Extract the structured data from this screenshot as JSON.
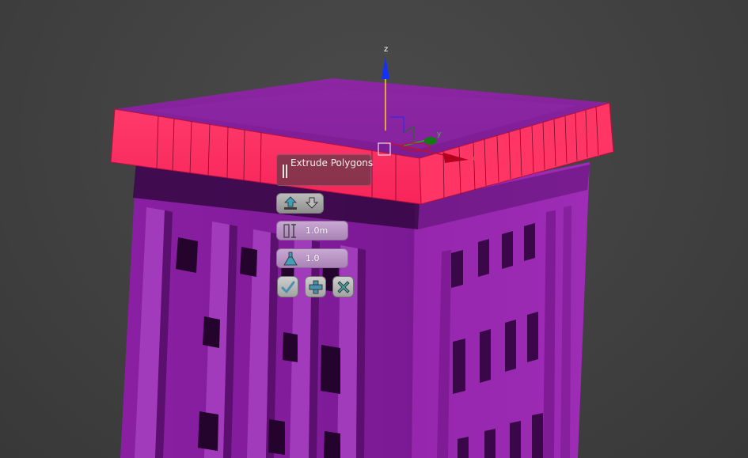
{
  "viewport": {
    "background": "#434343",
    "building_color": "#9b2bb3",
    "selected_face_color": "#ff2f63",
    "roof_color": "#8b249f"
  },
  "gizmo": {
    "z_label": "z",
    "x_label": "x",
    "y_label": "y"
  },
  "caddy": {
    "title": "Extrude Polygons",
    "group_mode_icon": "extrude-group-icon",
    "height_value": "1.0m",
    "height_icon": "height-icon",
    "bias_value": "1.0",
    "bias_icon": "flask-icon",
    "ok_icon": "checkmark-icon",
    "apply_icon": "plus-icon",
    "cancel_icon": "x-icon"
  }
}
